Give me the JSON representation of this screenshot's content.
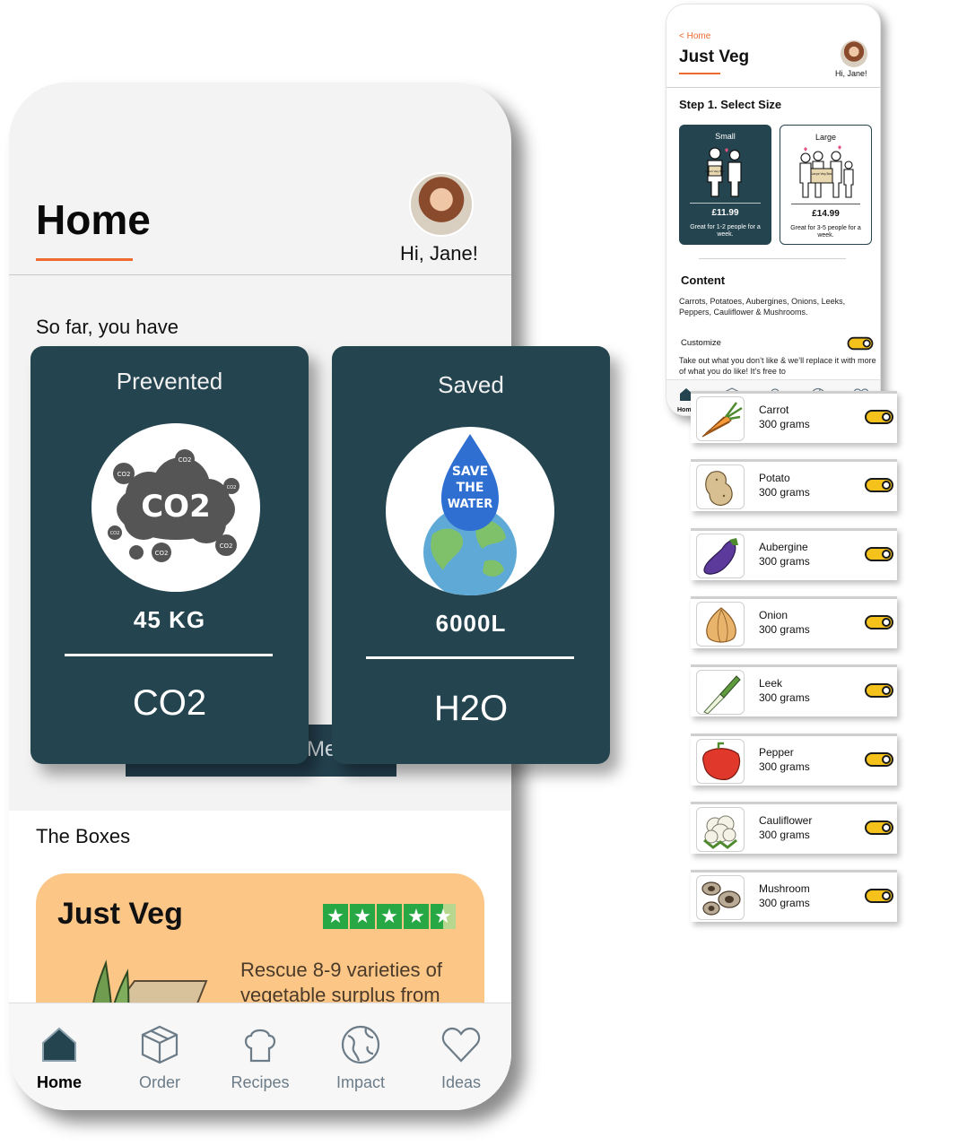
{
  "main_phone": {
    "title": "Home",
    "greeting": "Hi, Jane!",
    "so_far": "So far, you have",
    "more_button_partial": "Me",
    "boxes_heading": "The Boxes",
    "box_card": {
      "title": "Just Veg",
      "rating_stars": 4.5,
      "description": "Rescue 8-9 varieties of vegetable surplus from"
    },
    "nav": [
      {
        "label": "Home",
        "icon": "home-icon",
        "active": true
      },
      {
        "label": "Order",
        "icon": "box-icon",
        "active": false
      },
      {
        "label": "Recipes",
        "icon": "chef-hat-icon",
        "active": false
      },
      {
        "label": "Impact",
        "icon": "globe-icon",
        "active": false
      },
      {
        "label": "Ideas",
        "icon": "heart-icon",
        "active": false
      }
    ]
  },
  "stats": [
    {
      "heading": "Prevented",
      "value": "45 KG",
      "unit": "CO2",
      "icon": "co2-cloud-icon"
    },
    {
      "heading": "Saved",
      "value": "6000L",
      "unit": "H2O",
      "icon": "save-the-water-icon",
      "illustration_text": "SAVE THE WATER"
    }
  ],
  "co2_labels": [
    "CO2",
    "CO2",
    "CO2",
    "CO2",
    "CO2",
    "CO2",
    "CO2"
  ],
  "secondary_phone": {
    "back_label": "< Home",
    "title": "Just Veg",
    "greeting": "Hi, Jane!",
    "step_title": "Step 1. Select Size",
    "sizes": [
      {
        "name": "Small",
        "price": "£11.99",
        "desc": "Great for 1-2 people for a week.",
        "selected": true,
        "sign": "Small Veg Box"
      },
      {
        "name": "Large",
        "price": "£14.99",
        "desc": "Great for 3-5 people for a week.",
        "selected": false,
        "sign": "Large Veg Box"
      }
    ],
    "content_heading": "Content",
    "content_list": "Carrots, Potatoes, Aubergines, Onions, Leeks, Peppers, Cauliflower & Mushrooms.",
    "customize_label": "Customize",
    "customize_on": true,
    "customize_note": "Take out what you don’t like & we’ll replace it with more of what you do like!  It’s free to",
    "nav_home_label": "Hom"
  },
  "veg_items": [
    {
      "name": "Carrot",
      "amount": "300 grams",
      "on": true,
      "icon": "carrot-icon"
    },
    {
      "name": "Potato",
      "amount": "300 grams",
      "on": true,
      "icon": "potato-icon"
    },
    {
      "name": "Aubergine",
      "amount": "300 grams",
      "on": true,
      "icon": "aubergine-icon"
    },
    {
      "name": "Onion",
      "amount": "300 grams",
      "on": true,
      "icon": "onion-icon"
    },
    {
      "name": "Leek",
      "amount": "300 grams",
      "on": true,
      "icon": "leek-icon"
    },
    {
      "name": "Pepper",
      "amount": "300 grams",
      "on": true,
      "icon": "pepper-icon"
    },
    {
      "name": "Cauliflower",
      "amount": "300 grams",
      "on": true,
      "icon": "cauliflower-icon"
    },
    {
      "name": "Mushroom",
      "amount": "300 grams",
      "on": true,
      "icon": "mushroom-icon"
    }
  ],
  "colors": {
    "accent_orange": "#ef6a2e",
    "card_navy": "#24444f",
    "box_card_peach": "#fcc687",
    "toggle_yellow": "#f4c21a",
    "trustpilot_green": "#28a745"
  }
}
